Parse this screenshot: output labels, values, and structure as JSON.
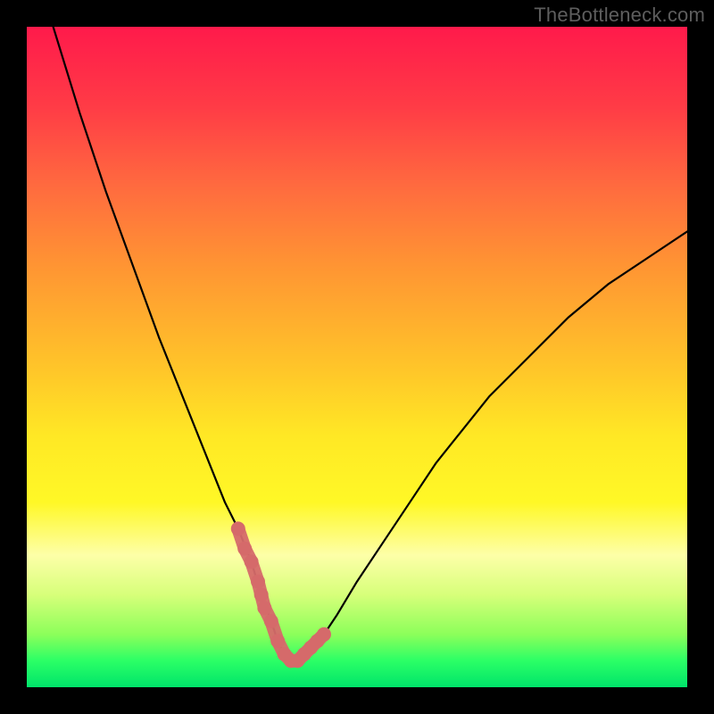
{
  "watermark": {
    "text": "TheBottleneck.com"
  },
  "colors": {
    "background": "#000000",
    "curve_stroke": "#000000",
    "highlight_stroke": "#d56a6a",
    "gradient_top": "#ff1a4b",
    "gradient_bottom": "#00e46a"
  },
  "chart_data": {
    "type": "line",
    "title": "",
    "xlabel": "",
    "ylabel": "",
    "xlim": [
      0,
      100
    ],
    "ylim": [
      0,
      100
    ],
    "grid": false,
    "legend": false,
    "x": [
      4,
      8,
      12,
      16,
      20,
      24,
      28,
      30,
      32,
      34,
      35.5,
      37,
      38,
      39,
      40,
      41,
      42,
      43,
      45,
      47,
      50,
      54,
      58,
      62,
      66,
      70,
      76,
      82,
      88,
      94,
      100
    ],
    "values": [
      100,
      87,
      75,
      64,
      53,
      43,
      33,
      28,
      24,
      19,
      14,
      10,
      7,
      5,
      4,
      4,
      5,
      6,
      8,
      11,
      16,
      22,
      28,
      34,
      39,
      44,
      50,
      56,
      61,
      65,
      69
    ],
    "series": [
      {
        "name": "bottleneck-curve",
        "values": [
          100,
          87,
          75,
          64,
          53,
          43,
          33,
          28,
          24,
          19,
          14,
          10,
          7,
          5,
          4,
          4,
          5,
          6,
          8,
          11,
          16,
          22,
          28,
          34,
          39,
          44,
          50,
          56,
          61,
          65,
          69
        ]
      }
    ],
    "highlight_range_x": [
      32,
      45
    ],
    "highlight_points": {
      "x": [
        32,
        33,
        34,
        35,
        35.5,
        36,
        37,
        38,
        39,
        40,
        41,
        42,
        43,
        44,
        45
      ],
      "values": [
        24,
        21,
        19,
        16,
        14,
        12,
        10,
        7,
        5,
        4,
        4,
        5,
        6,
        7,
        8
      ]
    },
    "annotations": []
  }
}
